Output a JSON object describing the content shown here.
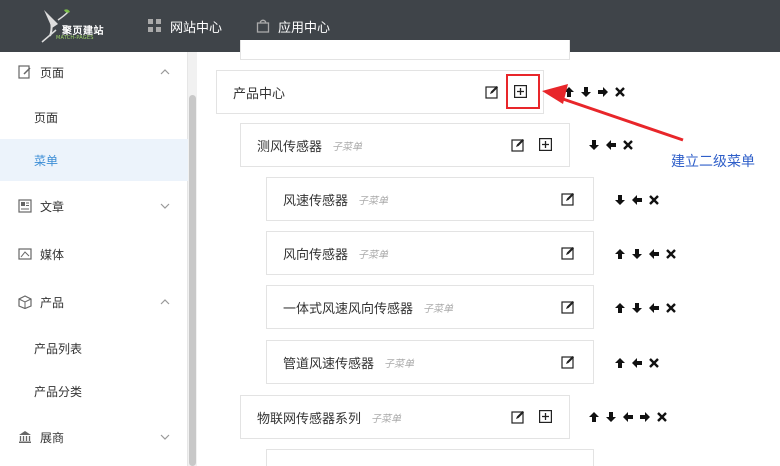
{
  "header": {
    "logo_text": "聚页建站",
    "logo_sub": "MATCH-PAGES",
    "nav": [
      {
        "label": "网站中心",
        "icon": "grid-icon"
      },
      {
        "label": "应用中心",
        "icon": "bag-icon"
      }
    ]
  },
  "sidebar": {
    "items": [
      {
        "label": "页面",
        "icon": "page-edit-icon",
        "expanded": true
      },
      {
        "label": "页面"
      },
      {
        "label": "菜单",
        "active": true
      },
      {
        "label": "文章",
        "icon": "article-icon",
        "expanded": false
      },
      {
        "label": "媒体",
        "icon": "media-icon"
      },
      {
        "label": "产品",
        "icon": "product-box-icon",
        "expanded": true
      },
      {
        "label": "产品列表"
      },
      {
        "label": "产品分类"
      },
      {
        "label": "展商",
        "icon": "building-icon",
        "expanded": false
      }
    ]
  },
  "menu_tree": {
    "submenu_tag": "子菜单",
    "nodes": [
      {
        "label": "产品中心",
        "level": 0,
        "arrows": [
          "up",
          "down",
          "right",
          "remove"
        ]
      },
      {
        "label": "测风传感器",
        "level": 1,
        "arrows": [
          "down",
          "left",
          "remove"
        ]
      },
      {
        "label": "风速传感器",
        "level": 2,
        "arrows": [
          "down",
          "left",
          "remove"
        ]
      },
      {
        "label": "风向传感器",
        "level": 2,
        "arrows": [
          "up",
          "down",
          "left",
          "remove"
        ]
      },
      {
        "label": "一体式风速风向传感器",
        "level": 2,
        "arrows": [
          "up",
          "down",
          "left",
          "remove"
        ]
      },
      {
        "label": "管道风速传感器",
        "level": 2,
        "arrows": [
          "up",
          "left",
          "remove"
        ]
      },
      {
        "label": "物联网传感器系列",
        "level": 1,
        "arrows": [
          "up",
          "down",
          "left",
          "right",
          "remove"
        ]
      }
    ]
  },
  "annotation": {
    "callout": "建立二级菜单",
    "color": "#e8262a"
  }
}
